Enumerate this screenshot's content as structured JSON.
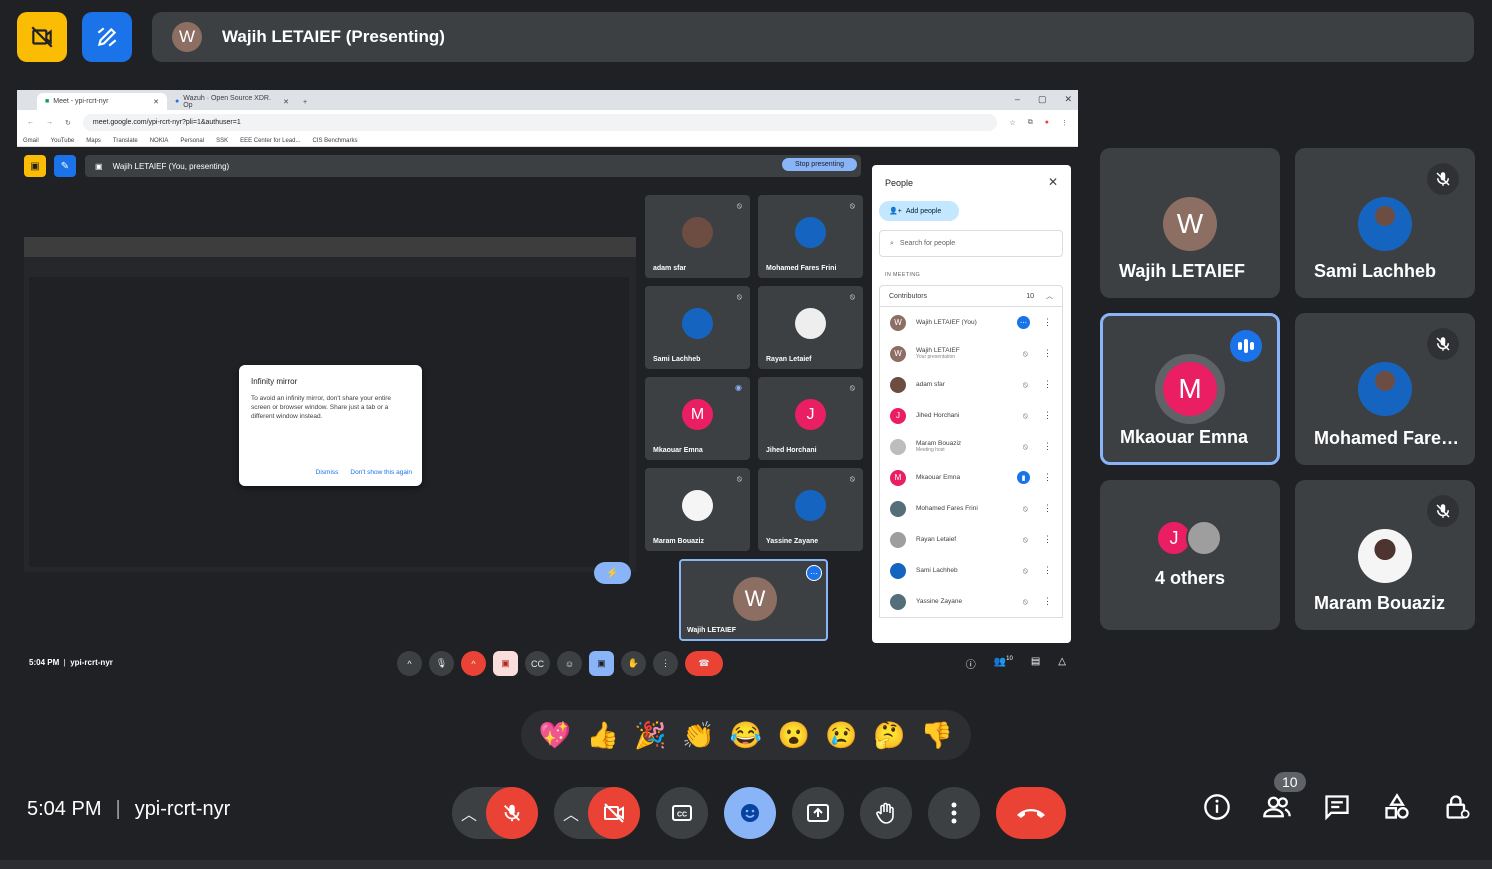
{
  "presenter": {
    "initial": "W",
    "label": "Wajih LETAIEF (Presenting)"
  },
  "browser": {
    "tabs": [
      {
        "label": "Meet - ypi-rcrt-nyr"
      },
      {
        "label": "Wazuh · Open Source XDR. Op"
      }
    ],
    "url": "meet.google.com/ypi-rcrt-nyr?pli=1&authuser=1",
    "bookmarks": [
      "Gmail",
      "YouTube",
      "Maps",
      "Translate",
      "NOKIA",
      "Personal",
      "SSK",
      "EEE Center for Lead...",
      "CIS Benchmarks"
    ]
  },
  "inner": {
    "presenting_label": "Wajih LETAIEF (You, presenting)",
    "stop_label": "Stop presenting",
    "dialog": {
      "title": "Infinity mirror",
      "body": "To avoid an infinity mirror, don't share your entire screen or browser window. Share just a tab or a different window instead.",
      "dismiss": "Dismiss",
      "dont_show": "Don't show this again"
    },
    "tiles": [
      {
        "name": "adam sfar",
        "initial": "",
        "color": "#6d4c41"
      },
      {
        "name": "Mohamed Fares Frini",
        "initial": "",
        "color": "#1565c0"
      },
      {
        "name": "Sami Lachheb",
        "initial": "",
        "color": "#1565c0"
      },
      {
        "name": "Rayan Letaief",
        "initial": "",
        "color": "#eeeeee"
      },
      {
        "name": "Mkaouar Emna",
        "initial": "M",
        "color": "#e91e63"
      },
      {
        "name": "Jihed Horchani",
        "initial": "J",
        "color": "#e91e63"
      },
      {
        "name": "Maram Bouaziz",
        "initial": "",
        "color": "#f5f5f5"
      },
      {
        "name": "Yassine Zayane",
        "initial": "",
        "color": "#1565c0"
      }
    ],
    "self": {
      "initial": "W",
      "name": "Wajih LETAIEF"
    },
    "time": "5:04 PM",
    "code": "ypi-rcrt-nyr",
    "people_count": "10"
  },
  "people_panel": {
    "title": "People",
    "add_label": "Add people",
    "search_placeholder": "Search for people",
    "section": "IN MEETING",
    "group": "Contributors",
    "count": "10",
    "rows": [
      {
        "name": "Wajih LETAIEF (You)",
        "sub": "",
        "initial": "W",
        "color": "#8d6e63"
      },
      {
        "name": "Wajih LETAIEF",
        "sub": "Your presentation",
        "initial": "W",
        "color": "#8d6e63"
      },
      {
        "name": "adam sfar",
        "sub": "",
        "initial": "",
        "color": "#6d4c41"
      },
      {
        "name": "Jihed Horchani",
        "sub": "",
        "initial": "J",
        "color": "#e91e63"
      },
      {
        "name": "Maram Bouaziz",
        "sub": "Meeting host",
        "initial": "",
        "color": "#bdbdbd"
      },
      {
        "name": "Mkaouar Emna",
        "sub": "",
        "initial": "M",
        "color": "#e91e63"
      },
      {
        "name": "Mohamed Fares Frini",
        "sub": "",
        "initial": "",
        "color": "#546e7a"
      },
      {
        "name": "Rayan Letaief",
        "sub": "",
        "initial": "",
        "color": "#9e9e9e"
      },
      {
        "name": "Sami Lachheb",
        "sub": "",
        "initial": "",
        "color": "#1565c0"
      },
      {
        "name": "Yassine Zayane",
        "sub": "",
        "initial": "",
        "color": "#546e7a"
      }
    ]
  },
  "grid": {
    "wajih": {
      "initial": "W",
      "name": "Wajih LETAIEF"
    },
    "sami": {
      "name": "Sami Lachheb"
    },
    "emna": {
      "initial": "M",
      "name": "Mkaouar Emna"
    },
    "fares": {
      "name": "Mohamed Fare…"
    },
    "others": {
      "label": "4 others",
      "initial": "J"
    },
    "maram": {
      "name": "Maram Bouaziz"
    }
  },
  "reactions": [
    "💖",
    "👍",
    "🎉",
    "👏",
    "😂",
    "😮",
    "😢",
    "🤔",
    "👎"
  ],
  "bottom": {
    "time": "5:04 PM",
    "separator": "|",
    "code": "ypi-rcrt-nyr",
    "people_count": "10"
  },
  "colors": {
    "accent": "#8ab4f8",
    "danger": "#ea4335",
    "surface": "#3c4043",
    "background": "#202124"
  }
}
